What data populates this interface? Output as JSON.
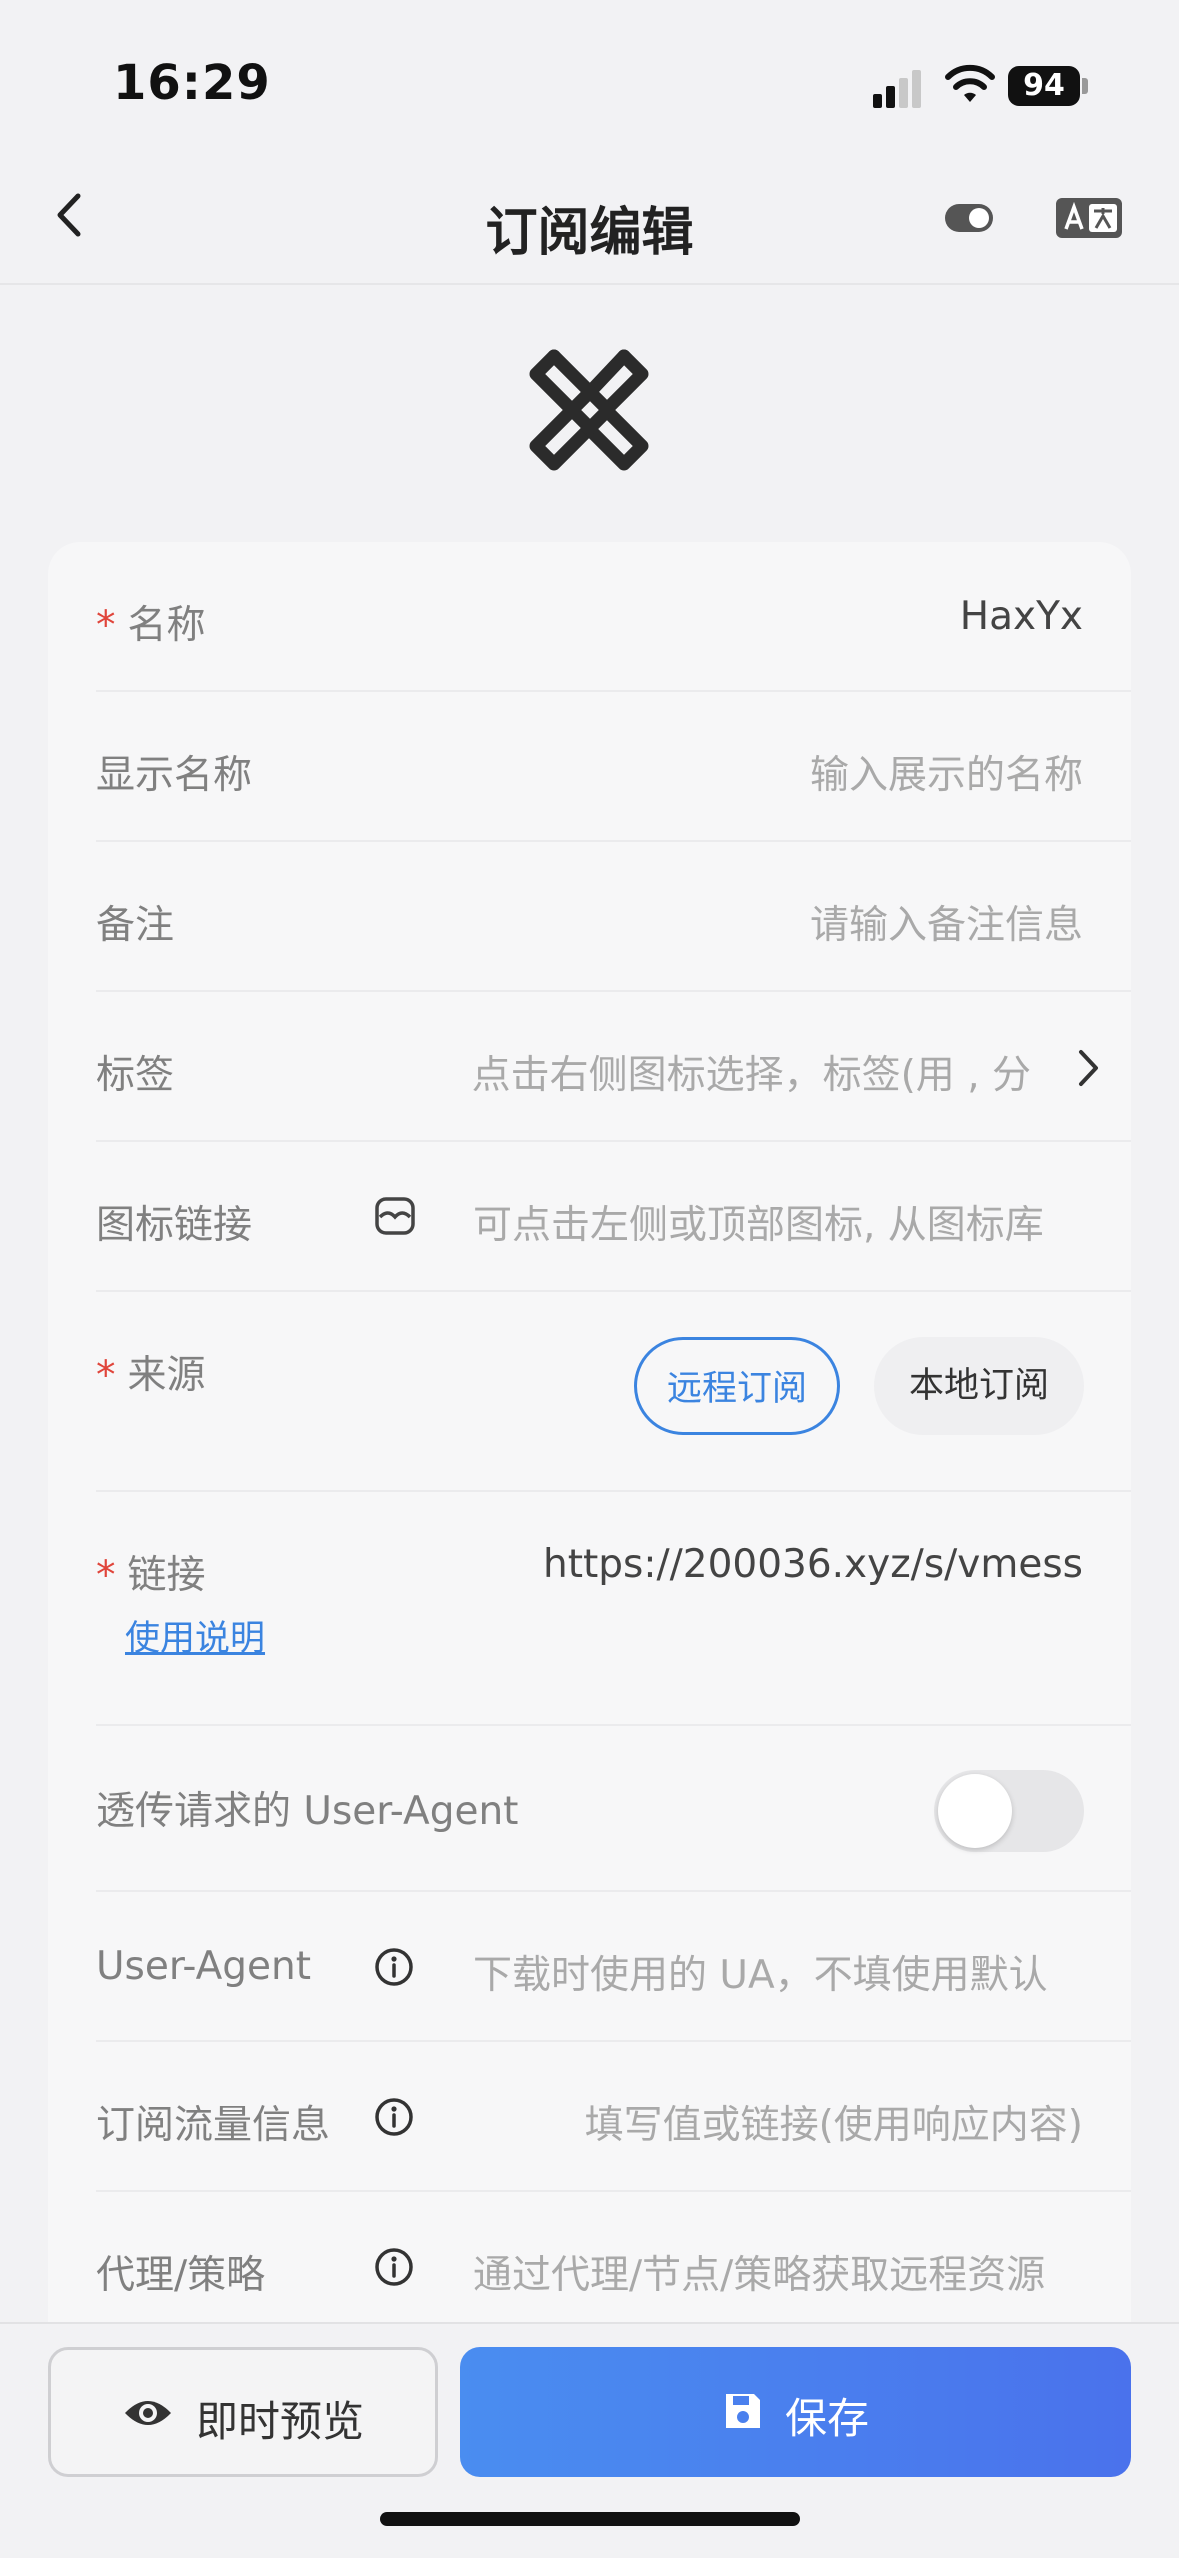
{
  "status_bar": {
    "time": "16:29",
    "battery": "94"
  },
  "nav": {
    "title": "订阅编辑"
  },
  "form": {
    "name": {
      "label": "名称",
      "value": "HaxYx"
    },
    "display_name": {
      "label": "显示名称",
      "placeholder": "输入展示的名称"
    },
    "remark": {
      "label": "备注",
      "placeholder": "请输入备注信息"
    },
    "tags": {
      "label": "标签",
      "placeholder": "点击右侧图标选择，标签(用 , 分"
    },
    "icon_link": {
      "label": "图标链接",
      "placeholder": "可点击左侧或顶部图标, 从图标库"
    },
    "source": {
      "label": "来源",
      "options": [
        "远程订阅",
        "本地订阅"
      ],
      "selected": "远程订阅"
    },
    "link": {
      "label": "链接",
      "value": "https://200036.xyz/s/vmess",
      "help": "使用说明"
    },
    "pass_ua": {
      "label": "透传请求的 User-Agent",
      "enabled": false
    },
    "user_agent": {
      "label": "User-Agent",
      "placeholder": "下载时使用的 UA，不填使用默认"
    },
    "traffic_info": {
      "label": "订阅流量信息",
      "placeholder": "填写值或链接(使用响应内容)"
    },
    "proxy": {
      "label": "代理/策略",
      "placeholder": "通过代理/节点/策略获取远程资源"
    }
  },
  "actions": {
    "preview": "即时预览",
    "save": "保存"
  },
  "colors": {
    "accent": "#3b84e0",
    "required": "#e0453b",
    "save_gradient_start": "#4a8df0",
    "save_gradient_end": "#4a72ec"
  }
}
